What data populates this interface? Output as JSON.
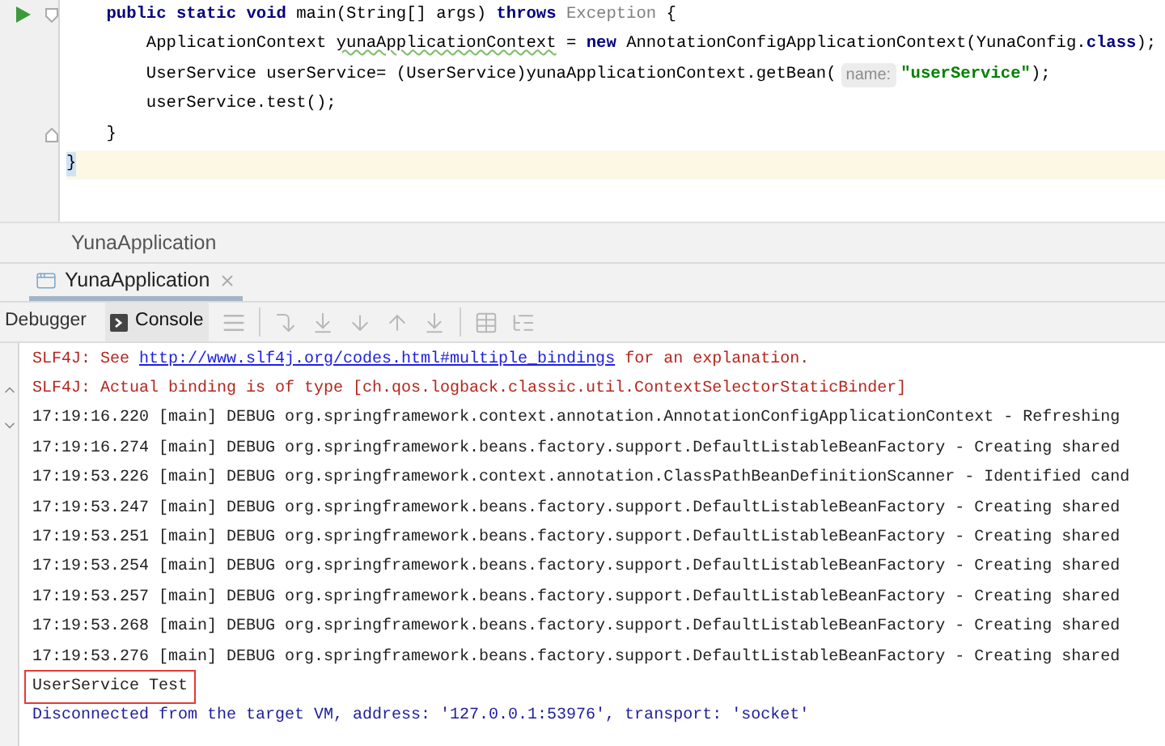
{
  "editor": {
    "lines": [
      {
        "run": true,
        "fold_start": true,
        "fold_end": false,
        "current": false,
        "segments": [
          {
            "kind": "keyword",
            "text": "    public static void"
          },
          {
            "kind": "plain",
            "text": " main(String[] args) "
          },
          {
            "kind": "keyword",
            "text": "throws"
          },
          {
            "kind": "muted",
            "text": " Exception"
          },
          {
            "kind": "plain",
            "text": " {"
          }
        ]
      },
      {
        "run": false,
        "fold_start": false,
        "fold_end": false,
        "current": false,
        "segments": [
          {
            "kind": "plain",
            "text": "        ApplicationContext "
          },
          {
            "kind": "typo",
            "text": "yunaApplicationContext"
          },
          {
            "kind": "plain",
            "text": " = "
          },
          {
            "kind": "keyword",
            "text": "new"
          },
          {
            "kind": "plain",
            "text": " AnnotationConfigApplicationContext(YunaConfig."
          },
          {
            "kind": "keyword",
            "text": "class"
          },
          {
            "kind": "plain",
            "text": ");"
          }
        ]
      },
      {
        "run": false,
        "fold_start": false,
        "fold_end": false,
        "current": false,
        "segments": [
          {
            "kind": "plain",
            "text": "        UserService userService= (UserService)yunaApplicationContext.getBean("
          },
          {
            "kind": "hint",
            "text": "name:"
          },
          {
            "kind": "string",
            "text": "\"userService\""
          },
          {
            "kind": "plain",
            "text": ");"
          }
        ]
      },
      {
        "run": false,
        "fold_start": false,
        "fold_end": false,
        "current": false,
        "segments": [
          {
            "kind": "plain",
            "text": "        userService.test();"
          }
        ]
      },
      {
        "run": false,
        "fold_start": false,
        "fold_end": true,
        "current": false,
        "segments": [
          {
            "kind": "plain",
            "text": "    }"
          }
        ]
      },
      {
        "run": false,
        "fold_start": false,
        "fold_end": false,
        "current": true,
        "segments": [
          {
            "kind": "brace",
            "text": "}"
          }
        ]
      }
    ]
  },
  "run_panel": {
    "title": "YunaApplication"
  },
  "tabs": [
    {
      "label": "YunaApplication",
      "selected": true
    }
  ],
  "subtabs": [
    {
      "label": "Debugger",
      "selected": false
    },
    {
      "label": "Console",
      "selected": true
    }
  ],
  "console": {
    "lines": [
      {
        "boxed": false,
        "segments": [
          {
            "kind": "error",
            "text": "SLF4J: See "
          },
          {
            "kind": "link",
            "text": "http://www.slf4j.org/codes.html#multiple_bindings"
          },
          {
            "kind": "error",
            "text": " for an explanation."
          }
        ]
      },
      {
        "boxed": false,
        "segments": [
          {
            "kind": "error",
            "text": "SLF4J: Actual binding is of type [ch.qos.logback.classic.util.ContextSelectorStaticBinder]"
          }
        ]
      },
      {
        "boxed": false,
        "segments": [
          {
            "kind": "normal",
            "text": "17:19:16.220 [main] DEBUG org.springframework.context.annotation.AnnotationConfigApplicationContext - Refreshing"
          }
        ]
      },
      {
        "boxed": false,
        "segments": [
          {
            "kind": "normal",
            "text": "17:19:16.274 [main] DEBUG org.springframework.beans.factory.support.DefaultListableBeanFactory - Creating shared"
          }
        ]
      },
      {
        "boxed": false,
        "segments": [
          {
            "kind": "normal",
            "text": "17:19:53.226 [main] DEBUG org.springframework.context.annotation.ClassPathBeanDefinitionScanner - Identified cand"
          }
        ]
      },
      {
        "boxed": false,
        "segments": [
          {
            "kind": "normal",
            "text": "17:19:53.247 [main] DEBUG org.springframework.beans.factory.support.DefaultListableBeanFactory - Creating shared"
          }
        ]
      },
      {
        "boxed": false,
        "segments": [
          {
            "kind": "normal",
            "text": "17:19:53.251 [main] DEBUG org.springframework.beans.factory.support.DefaultListableBeanFactory - Creating shared"
          }
        ]
      },
      {
        "boxed": false,
        "segments": [
          {
            "kind": "normal",
            "text": "17:19:53.254 [main] DEBUG org.springframework.beans.factory.support.DefaultListableBeanFactory - Creating shared"
          }
        ]
      },
      {
        "boxed": false,
        "segments": [
          {
            "kind": "normal",
            "text": "17:19:53.257 [main] DEBUG org.springframework.beans.factory.support.DefaultListableBeanFactory - Creating shared"
          }
        ]
      },
      {
        "boxed": false,
        "segments": [
          {
            "kind": "normal",
            "text": "17:19:53.268 [main] DEBUG org.springframework.beans.factory.support.DefaultListableBeanFactory - Creating shared"
          }
        ]
      },
      {
        "boxed": false,
        "segments": [
          {
            "kind": "normal",
            "text": "17:19:53.276 [main] DEBUG org.springframework.beans.factory.support.DefaultListableBeanFactory - Creating shared"
          }
        ]
      },
      {
        "boxed": true,
        "segments": [
          {
            "kind": "normal",
            "text": "UserService Test"
          }
        ]
      },
      {
        "boxed": false,
        "segments": [
          {
            "kind": "system",
            "text": "Disconnected from the target VM, address: '127.0.0.1:53976', transport: 'socket'"
          }
        ]
      }
    ]
  }
}
